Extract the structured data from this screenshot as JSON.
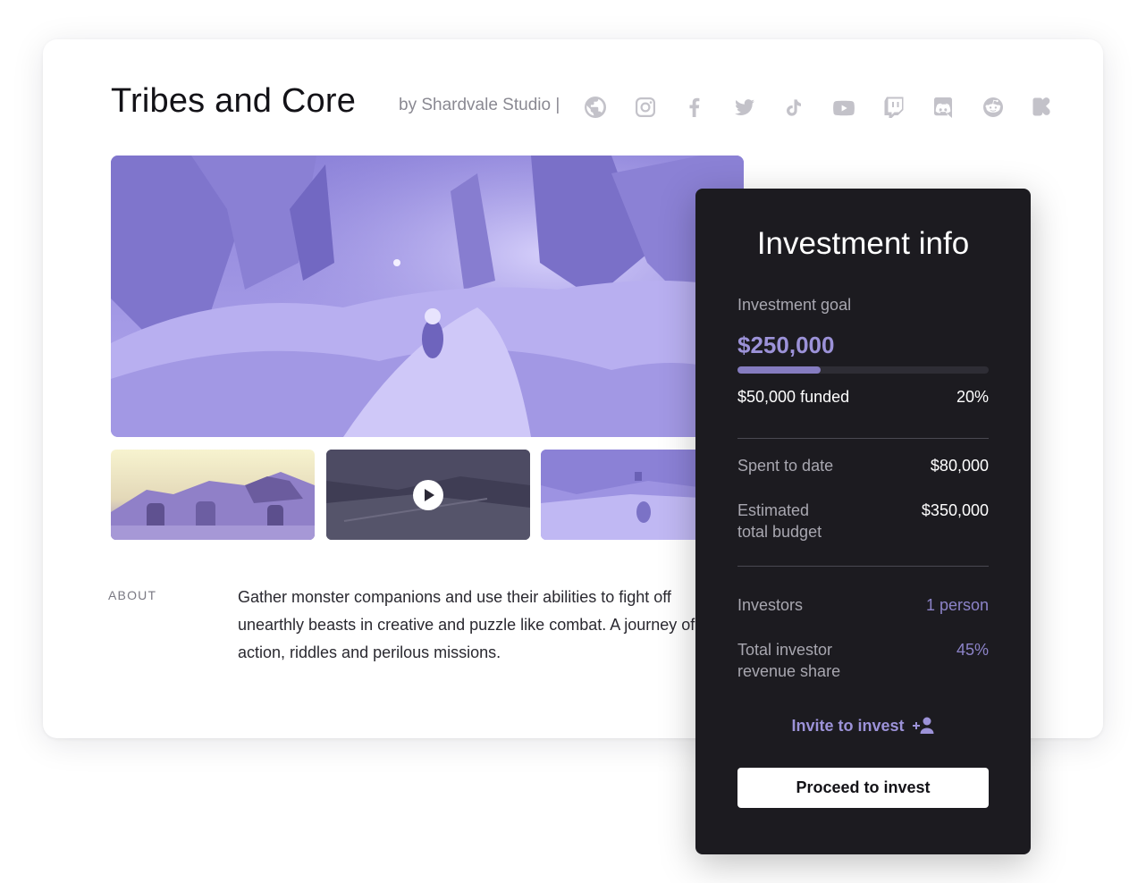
{
  "header": {
    "title": "Tribes and Core",
    "studio": "by Shardvale Studio |",
    "social_icons": [
      "globe-icon",
      "instagram-icon",
      "facebook-icon",
      "twitter-icon",
      "tiktok-icon",
      "youtube-icon",
      "twitch-icon",
      "discord-icon",
      "reddit-icon",
      "kickstarter-icon"
    ]
  },
  "about": {
    "label": "ABOUT",
    "text": "Gather monster companions and use their abilities to fight off unearthly beasts in creative and puzzle like combat. A journey of action, riddles and perilous missions."
  },
  "investment": {
    "title": "Investment info",
    "goal_label": "Investment goal",
    "goal_amount": "$250,000",
    "funded_amount": "$50,000",
    "funded_word": "funded",
    "funded_percent": "20%",
    "funded_fraction": 0.2,
    "spent_label": "Spent to date",
    "spent_value": "$80,000",
    "budget_label_line1": "Estimated",
    "budget_label_line2": "total budget",
    "budget_value": "$350,000",
    "investors_label": "Investors",
    "investors_value": "1 person",
    "revshare_label_line1": "Total investor",
    "revshare_label_line2": "revenue share",
    "revshare_value": "45%",
    "invite_label": "Invite to invest",
    "proceed_label": "Proceed to invest"
  },
  "colors": {
    "accent": "#9c92d8",
    "panel_bg": "#1c1b20",
    "media_tint": "#a59ae6"
  }
}
